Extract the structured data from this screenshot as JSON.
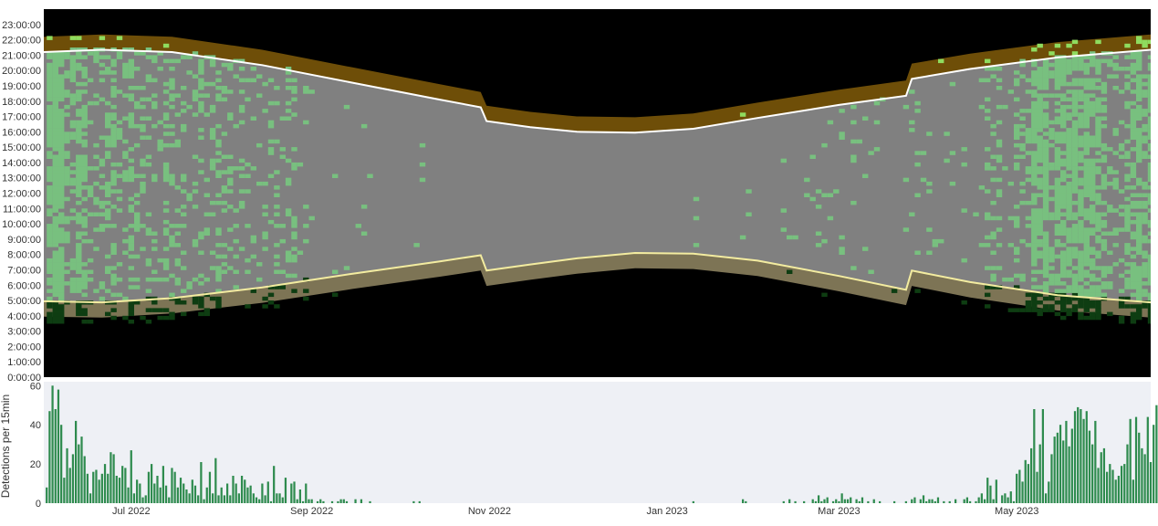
{
  "chart_data": [
    {
      "type": "heatmap",
      "description_series": [
        "detections",
        "night",
        "twilight",
        "daylight"
      ],
      "x_ticks": [
        "Jul 2022",
        "Sep 2022",
        "Nov 2022",
        "Jan 2023",
        "Mar 2023",
        "May 2023"
      ],
      "x_tick_dates": [
        "2022-07-01",
        "2022-09-01",
        "2022-11-01",
        "2023-01-01",
        "2023-03-01",
        "2023-05-01"
      ],
      "x_range": [
        "2022-06-01",
        "2023-06-16"
      ],
      "y_ticks": [
        "0:00:00",
        "1:00:00",
        "2:00:00",
        "3:00:00",
        "4:00:00",
        "5:00:00",
        "6:00:00",
        "7:00:00",
        "8:00:00",
        "9:00:00",
        "10:00:00",
        "11:00:00",
        "12:00:00",
        "13:00:00",
        "14:00:00",
        "15:00:00",
        "16:00:00",
        "17:00:00",
        "18:00:00",
        "19:00:00",
        "20:00:00",
        "21:00:00",
        "22:00:00",
        "23:00:00"
      ],
      "y_range_hours": [
        0,
        24
      ],
      "sunrise_hours": [
        [
          "2022-06-01",
          4.95
        ],
        [
          "2022-06-21",
          4.88
        ],
        [
          "2022-07-15",
          5.15
        ],
        [
          "2022-08-15",
          5.85
        ],
        [
          "2022-09-15",
          6.75
        ],
        [
          "2022-10-15",
          7.55
        ],
        [
          "2022-10-29",
          7.95
        ],
        [
          "2022-10-31",
          6.95
        ],
        [
          "2022-11-15",
          7.35
        ],
        [
          "2022-12-01",
          7.75
        ],
        [
          "2022-12-21",
          8.1
        ],
        [
          "2023-01-10",
          8.05
        ],
        [
          "2023-02-01",
          7.6
        ],
        [
          "2023-03-01",
          6.6
        ],
        [
          "2023-03-24",
          5.7
        ],
        [
          "2023-03-26",
          6.95
        ],
        [
          "2023-04-15",
          6.2
        ],
        [
          "2023-05-15",
          5.35
        ],
        [
          "2023-06-16",
          4.88
        ]
      ],
      "sunset_hours": [
        [
          "2022-06-01",
          21.2
        ],
        [
          "2022-06-21",
          21.35
        ],
        [
          "2022-07-15",
          21.2
        ],
        [
          "2022-08-15",
          20.35
        ],
        [
          "2022-09-15",
          19.2
        ],
        [
          "2022-10-15",
          18.1
        ],
        [
          "2022-10-29",
          17.6
        ],
        [
          "2022-10-31",
          16.7
        ],
        [
          "2022-11-15",
          16.3
        ],
        [
          "2022-12-01",
          16.0
        ],
        [
          "2022-12-21",
          15.95
        ],
        [
          "2023-01-10",
          16.2
        ],
        [
          "2023-02-01",
          16.9
        ],
        [
          "2023-03-01",
          17.75
        ],
        [
          "2023-03-24",
          18.35
        ],
        [
          "2023-03-26",
          19.45
        ],
        [
          "2023-04-15",
          20.1
        ],
        [
          "2023-05-15",
          20.85
        ],
        [
          "2023-06-16",
          21.35
        ]
      ],
      "twilight_hours": 1.0,
      "colors": {
        "night": "#000000",
        "daylight": "#808080",
        "dawn_twilight": "#7d7455",
        "dusk_twilight": "#6e4e08",
        "sunrise_line": "#f3eca0",
        "sunset_line": "#ffffff",
        "detection_light": "#78c07f",
        "detection_mid": "#6fbf73",
        "detection_dark": "#0e3d12",
        "detection_bright": "#8fdc5e"
      }
    },
    {
      "type": "bar",
      "ylabel": "Detections per 15min",
      "y_ticks": [
        0,
        20,
        40,
        60
      ],
      "ylim": [
        0,
        62
      ],
      "x_range": [
        "2022-06-01",
        "2023-06-16"
      ],
      "color": "#2e8b4e",
      "background": "#eef0f5",
      "start_date": "2022-06-02",
      "values": [
        8,
        47,
        60,
        48,
        58,
        40,
        13,
        28,
        18,
        25,
        42,
        30,
        34,
        24,
        15,
        5,
        16,
        17,
        12,
        15,
        20,
        15,
        26,
        25,
        14,
        13,
        19,
        18,
        8,
        27,
        5,
        12,
        10,
        3,
        4,
        16,
        20,
        10,
        14,
        8,
        19,
        9,
        3,
        18,
        16,
        8,
        13,
        10,
        7,
        5,
        12,
        9,
        4,
        21,
        2,
        8,
        16,
        5,
        23,
        4,
        8,
        4,
        10,
        4,
        14,
        10,
        5,
        14,
        12,
        8,
        9,
        5,
        3,
        2,
        10,
        4,
        11,
        1,
        19,
        5,
        5,
        3,
        13,
        0,
        10,
        11,
        2,
        7,
        1,
        10,
        2,
        2,
        0,
        1,
        2,
        1,
        0,
        0,
        1,
        0,
        1,
        2,
        2,
        1,
        0,
        0,
        2,
        0,
        2,
        0,
        0,
        1,
        0,
        0,
        0,
        0,
        0,
        0,
        0,
        0,
        0,
        0,
        0,
        0,
        0,
        0,
        1,
        0,
        1,
        0,
        0,
        0,
        0,
        0,
        0,
        0,
        0,
        0,
        0,
        0,
        0,
        0,
        0,
        0,
        0,
        0,
        0,
        0,
        0,
        0,
        0,
        0,
        0,
        0,
        0,
        0,
        0,
        0,
        0,
        0,
        0,
        0,
        0,
        0,
        0,
        0,
        0,
        0,
        0,
        0,
        0,
        0,
        0,
        0,
        0,
        0,
        0,
        0,
        0,
        0,
        0,
        0,
        0,
        0,
        0,
        0,
        0,
        0,
        0,
        0,
        0,
        0,
        0,
        0,
        0,
        0,
        0,
        0,
        0,
        0,
        0,
        0,
        0,
        0,
        0,
        0,
        0,
        0,
        0,
        0,
        0,
        0,
        0,
        0,
        0,
        0,
        0,
        0,
        0,
        0,
        0,
        0,
        1,
        0,
        0,
        0,
        0,
        0,
        0,
        0,
        0,
        0,
        0,
        0,
        0,
        0,
        0,
        0,
        0,
        2,
        1,
        0,
        0,
        0,
        0,
        0,
        0,
        0,
        0,
        0,
        0,
        0,
        0,
        1,
        0,
        2,
        0,
        1,
        0,
        0,
        1,
        0,
        0,
        2,
        1,
        4,
        1,
        2,
        3,
        0,
        1,
        2,
        1,
        5,
        2,
        2,
        3,
        0,
        2,
        1,
        3,
        0,
        1,
        0,
        2,
        0,
        1,
        0,
        0,
        0,
        0,
        1,
        0,
        0,
        0,
        1,
        0,
        2,
        3,
        0,
        2,
        4,
        1,
        2,
        2,
        1,
        3,
        0,
        1,
        0,
        1,
        0,
        2,
        0,
        0,
        2,
        3,
        1,
        0,
        1,
        3,
        5,
        2,
        13,
        9,
        2,
        12,
        0,
        4,
        5,
        3,
        6,
        1,
        15,
        17,
        11,
        22,
        20,
        28,
        48,
        16,
        30,
        48,
        5,
        11,
        25,
        34,
        36,
        40,
        32,
        42,
        29,
        38,
        47,
        49,
        48,
        43,
        47,
        37,
        30,
        42,
        18,
        26,
        28,
        16,
        20,
        17,
        12,
        14,
        19,
        20,
        30,
        43,
        12,
        44,
        36,
        28,
        25,
        44,
        21,
        40,
        50,
        41,
        46,
        43,
        55,
        61,
        43,
        54,
        52,
        42,
        58,
        50,
        30,
        41,
        44,
        42,
        49,
        43,
        56,
        48,
        47,
        44,
        45,
        58,
        43
      ]
    }
  ]
}
